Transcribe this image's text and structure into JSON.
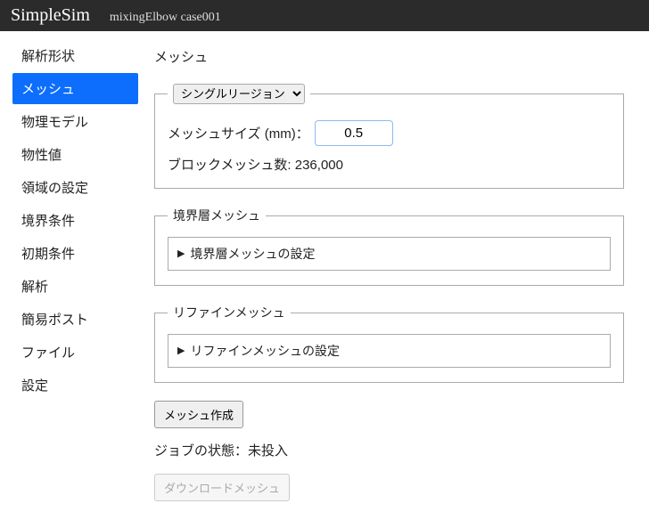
{
  "header": {
    "brand": "SimpleSim",
    "case_name": "mixingElbow case001"
  },
  "sidebar": {
    "items": [
      {
        "label": "解析形状"
      },
      {
        "label": "メッシュ"
      },
      {
        "label": "物理モデル"
      },
      {
        "label": "物性値"
      },
      {
        "label": "領域の設定"
      },
      {
        "label": "境界条件"
      },
      {
        "label": "初期条件"
      },
      {
        "label": "解析"
      },
      {
        "label": "簡易ポスト"
      },
      {
        "label": "ファイル"
      },
      {
        "label": "設定"
      }
    ],
    "active_index": 1
  },
  "main": {
    "title": "メッシュ",
    "region_select": {
      "selected": "シングルリージョン"
    },
    "mesh_size": {
      "label": "メッシュサイズ (mm)：",
      "value": "0.5"
    },
    "block_count": {
      "label": "ブロックメッシュ数:",
      "value": "236,000"
    },
    "boundary_layer": {
      "legend": "境界層メッシュ",
      "expander_label": "境界層メッシュの設定"
    },
    "refine": {
      "legend": "リファインメッシュ",
      "expander_label": "リファインメッシュの設定"
    },
    "create_button": "メッシュ作成",
    "job_status": {
      "label": "ジョブの状態：",
      "value": "未投入"
    },
    "download_button": "ダウンロードメッシュ"
  }
}
